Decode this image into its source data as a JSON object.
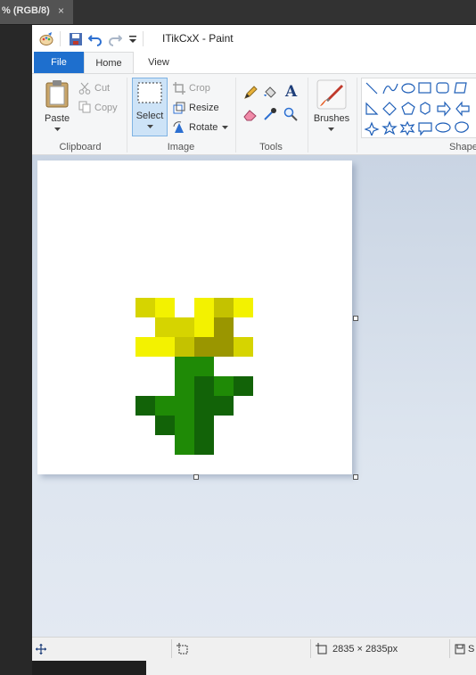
{
  "photoshop": {
    "tab_label": "% (RGB/8)",
    "tab_close": "×"
  },
  "paint": {
    "title": "ITikCxX - Paint",
    "tabs": {
      "file": "File",
      "home": "Home",
      "view": "View"
    },
    "clipboard": {
      "group": "Clipboard",
      "paste": "Paste",
      "cut": "Cut",
      "copy": "Copy"
    },
    "image": {
      "group": "Image",
      "select": "Select",
      "crop": "Crop",
      "resize": "Resize",
      "rotate": "Rotate"
    },
    "tools": {
      "group": "Tools",
      "text_tool_glyph": "A"
    },
    "brushes": {
      "label": "Brushes"
    },
    "shapes": {
      "group": "Shapes"
    },
    "status": {
      "dimensions": "2835 × 2835px",
      "size_prefix": "S"
    },
    "pixel_art": {
      "colors": {
        "Y1": "#f3f200",
        "Y2": "#d6d400",
        "Y3": "#c4c200",
        "O1": "#9a9600",
        "G1": "#1f8a06",
        "G2": "#126308"
      },
      "grid": [
        [
          "",
          "",
          "",
          "",
          "",
          "",
          "",
          "",
          "",
          "",
          "",
          "",
          "",
          "",
          "",
          ""
        ],
        [
          "",
          "",
          "",
          "",
          "",
          "",
          "",
          "",
          "",
          "",
          "",
          "",
          "",
          "",
          "",
          ""
        ],
        [
          "",
          "",
          "",
          "",
          "",
          "",
          "",
          "",
          "",
          "",
          "",
          "",
          "",
          "",
          "",
          ""
        ],
        [
          "",
          "",
          "",
          "",
          "",
          "",
          "",
          "",
          "",
          "",
          "",
          "",
          "",
          "",
          "",
          ""
        ],
        [
          "",
          "",
          "",
          "",
          "",
          "",
          "",
          "",
          "",
          "",
          "",
          "",
          "",
          "",
          "",
          ""
        ],
        [
          "",
          "",
          "",
          "",
          "",
          "",
          "",
          "",
          "",
          "",
          "",
          "",
          "",
          "",
          "",
          ""
        ],
        [
          "",
          "",
          "",
          "",
          "",
          "",
          "",
          "",
          "",
          "",
          "",
          "",
          "",
          "",
          "",
          ""
        ],
        [
          "",
          "",
          "",
          "",
          "",
          "Y2",
          "Y1",
          "",
          "Y1",
          "Y3",
          "Y1",
          "",
          "",
          "",
          "",
          ""
        ],
        [
          "",
          "",
          "",
          "",
          "",
          "",
          "Y2",
          "Y2",
          "Y1",
          "O1",
          "",
          "",
          "",
          "",
          "",
          ""
        ],
        [
          "",
          "",
          "",
          "",
          "",
          "Y1",
          "Y1",
          "Y3",
          "O1",
          "O1",
          "Y2",
          "",
          "",
          "",
          "",
          ""
        ],
        [
          "",
          "",
          "",
          "",
          "",
          "",
          "",
          "G1",
          "G1",
          "",
          "",
          "",
          "",
          "",
          "",
          ""
        ],
        [
          "",
          "",
          "",
          "",
          "",
          "",
          "",
          "G1",
          "G2",
          "G1",
          "G2",
          "",
          "",
          "",
          "",
          ""
        ],
        [
          "",
          "",
          "",
          "",
          "",
          "G2",
          "G1",
          "G1",
          "G2",
          "G2",
          "",
          "",
          "",
          "",
          "",
          ""
        ],
        [
          "",
          "",
          "",
          "",
          "",
          "",
          "G2",
          "G1",
          "G2",
          "",
          "",
          "",
          "",
          "",
          "",
          ""
        ],
        [
          "",
          "",
          "",
          "",
          "",
          "",
          "",
          "G1",
          "G2",
          "",
          "",
          "",
          "",
          "",
          "",
          ""
        ],
        [
          "",
          "",
          "",
          "",
          "",
          "",
          "",
          "",
          "",
          "",
          "",
          "",
          "",
          "",
          "",
          ""
        ]
      ]
    }
  }
}
